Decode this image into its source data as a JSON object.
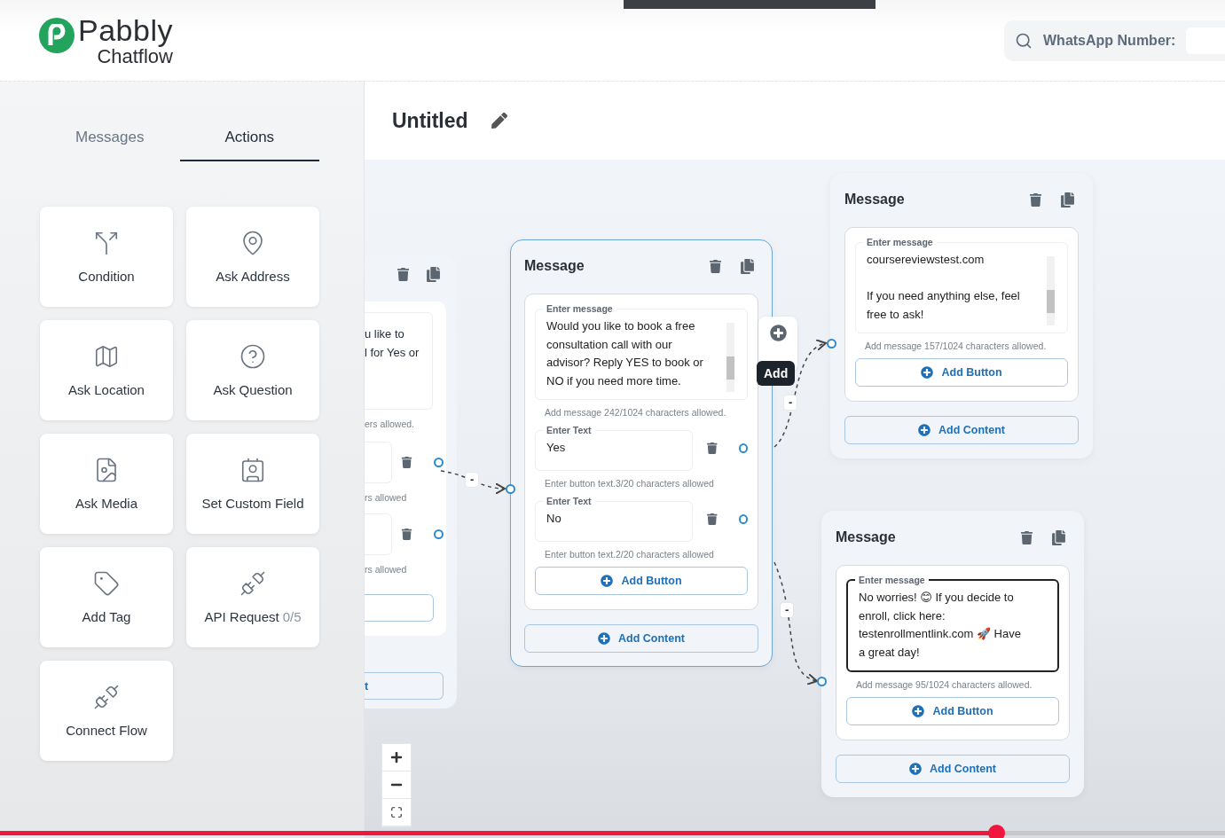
{
  "header": {
    "logo_top": "Pabbly",
    "logo_bottom": "Chatflow",
    "search_label": "WhatsApp Number:"
  },
  "sidebar": {
    "tabs": [
      {
        "label": "Messages",
        "selected": false
      },
      {
        "label": "Actions",
        "selected": true
      }
    ],
    "actions": [
      {
        "label": "Condition"
      },
      {
        "label": "Ask Address"
      },
      {
        "label": "Ask Location"
      },
      {
        "label": "Ask Question"
      },
      {
        "label": "Ask Media"
      },
      {
        "label": "Set Custom Field"
      },
      {
        "label": "Add Tag"
      },
      {
        "label": "API Request",
        "count": "0/5"
      },
      {
        "label": "Connect Flow"
      }
    ]
  },
  "flow": {
    "title": "Untitled"
  },
  "canvas": {
    "partial_node": {
      "message": "u like to\nl for Yes or",
      "counter": "ers allowed.",
      "button_counters": [
        "rs allowed",
        "rs allowed"
      ],
      "add_content": "t"
    },
    "nodes": [
      {
        "title": "Message",
        "selected": true,
        "focused": false,
        "scrollbar": true,
        "message_label": "Enter message",
        "message": "Would you like to book a free consultation call with our advisor? Reply YES to book or NO if you need more time.",
        "counter": "Add message 242/1024 characters allowed.",
        "buttons": [
          {
            "label": "Enter Text",
            "value": "Yes",
            "counter": "Enter button text.3/20 characters allowed"
          },
          {
            "label": "Enter Text",
            "value": "No",
            "counter": "Enter button text.2/20 characters allowed"
          }
        ],
        "add_button": "Add Button",
        "add_content": "Add Content"
      },
      {
        "title": "Message",
        "selected": false,
        "focused": false,
        "scrollbar": true,
        "message_label": "Enter message",
        "message": "coursereviewstest.com\n\nIf you need anything else, feel free to ask!",
        "counter": "Add message 157/1024 characters allowed.",
        "add_button": "Add Button",
        "add_content": "Add Content"
      },
      {
        "title": "Message",
        "selected": false,
        "focused": true,
        "scrollbar": false,
        "message_label": "Enter message",
        "message": "No worries! 😊 If you decide to enroll, click here: testenrollmentlink.com 🚀 Have a great day!",
        "counter": "Add message 95/1024 characters allowed.",
        "add_button": "Add Button",
        "add_content": "Add Content"
      }
    ],
    "tooltip": "Add",
    "edge_labels": [
      "-",
      "-",
      "-"
    ]
  },
  "video": {
    "level": 0.813
  }
}
